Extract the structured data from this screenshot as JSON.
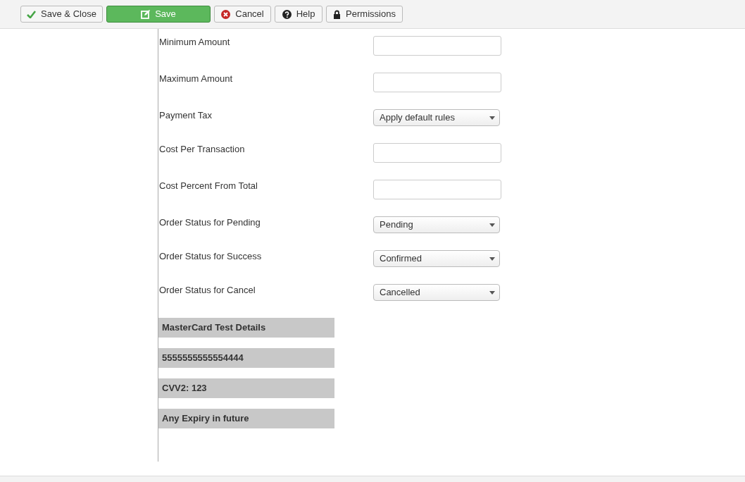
{
  "toolbar": [
    {
      "label": "Save & Close",
      "kind": "default"
    },
    {
      "label": "Save",
      "kind": "primary"
    },
    {
      "label": "Cancel",
      "kind": "default"
    },
    {
      "label": "Help",
      "kind": "default"
    },
    {
      "label": "Permissions",
      "kind": "default"
    }
  ],
  "fields": [
    {
      "label": "Minimum Amount",
      "kind": "text"
    },
    {
      "label": "Maximum Amount",
      "kind": "text"
    },
    {
      "label": "Payment Tax",
      "kind": "select",
      "value": "Apply default rules"
    },
    {
      "label": "Cost Per Transaction",
      "kind": "text"
    },
    {
      "label": "Cost Percent From Total",
      "kind": "text"
    },
    {
      "label": "Order Status for Pending",
      "kind": "select",
      "value": "Pending"
    },
    {
      "label": "Order Status for Success",
      "kind": "select",
      "value": "Confirmed"
    },
    {
      "label": "Order Status for Cancel",
      "kind": "select",
      "value": "Cancelled"
    }
  ],
  "test_details": [
    "MasterCard Test Details",
    "5555555555554444",
    "CVV2: 123",
    "Any Expiry in future"
  ]
}
